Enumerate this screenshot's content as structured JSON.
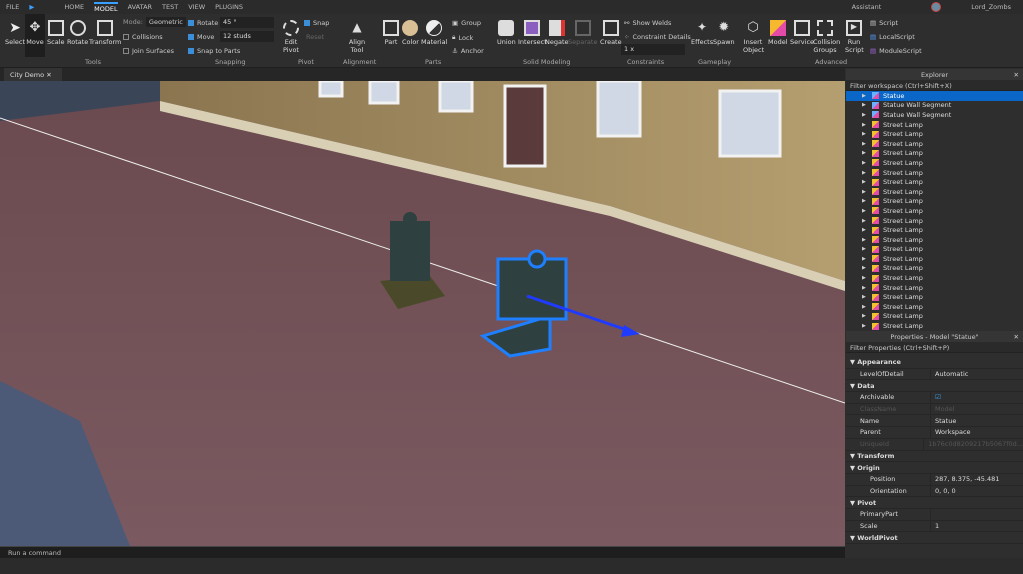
{
  "menubar": {
    "file": "FILE",
    "tabs": [
      "HOME",
      "MODEL",
      "AVATAR",
      "TEST",
      "VIEW",
      "PLUGINS"
    ],
    "active": "MODEL",
    "assistant": "Assistant",
    "user": "Lord_Zombs"
  },
  "tools": {
    "select": "Select",
    "move": "Move",
    "scale": "Scale",
    "rotate": "Rotate",
    "transform": "Transform",
    "mode_label": "Mode:",
    "mode": "Geometric",
    "collisions": "Collisions",
    "join": "Join Surfaces",
    "group": "Tools"
  },
  "snapping": {
    "rotate": "Rotate",
    "rotate_val": "45 °",
    "move": "Move",
    "move_val": "12 studs",
    "snap_parts": "Snap to Parts",
    "group": "Snapping"
  },
  "pivot": {
    "edit": "Edit Pivot",
    "snap": "Snap",
    "reset": "Reset",
    "group": "Pivot"
  },
  "alignment": {
    "align": "Align Tool",
    "group": "Alignment"
  },
  "parts": {
    "part": "Part",
    "color": "Color",
    "material": "Material",
    "group_btn": "Group",
    "lock": "Lock",
    "anchor": "Anchor",
    "group": "Parts"
  },
  "solid": {
    "union": "Union",
    "intersect": "Intersect",
    "negate": "Negate",
    "separate": "Separate",
    "group": "Solid Modeling"
  },
  "constraints": {
    "create": "Create",
    "welds": "Show Welds",
    "details": "Constraint Details",
    "scale": "1 x",
    "group": "Constraints"
  },
  "gameplay": {
    "effects": "Effects",
    "spawn": "Spawn",
    "group": "Gameplay"
  },
  "advanced": {
    "insert": "Insert Object",
    "model": "Model",
    "service": "Service",
    "collision": "Collision Groups",
    "run": "Run Script",
    "script": "Script",
    "local": "LocalScript",
    "module": "ModuleScript",
    "group": "Advanced"
  },
  "doc_tab": "City Demo",
  "command": "Run a command",
  "explorer": {
    "title": "Explorer",
    "filter": "Filter workspace (Ctrl+Shift+X)",
    "items": [
      "Statue",
      "Statue Wall Segment",
      "Statue Wall Segment",
      "Street Lamp",
      "Street Lamp",
      "Street Lamp",
      "Street Lamp",
      "Street Lamp",
      "Street Lamp",
      "Street Lamp",
      "Street Lamp",
      "Street Lamp",
      "Street Lamp",
      "Street Lamp",
      "Street Lamp",
      "Street Lamp",
      "Street Lamp",
      "Street Lamp",
      "Street Lamp",
      "Street Lamp",
      "Street Lamp",
      "Street Lamp",
      "Street Lamp",
      "Street Lamp",
      "Street Lamp"
    ]
  },
  "properties": {
    "title": "Properties - Model \"Statue\"",
    "filter": "Filter Properties (Ctrl+Shift+P)",
    "rows": [
      {
        "t": "cat",
        "k": "Appearance"
      },
      {
        "k": "LevelOfDetail",
        "v": "Automatic"
      },
      {
        "t": "cat",
        "k": "Data"
      },
      {
        "k": "Archivable",
        "v": "☑"
      },
      {
        "t": "dim",
        "k": "ClassName",
        "v": "Model"
      },
      {
        "k": "Name",
        "v": "Statue"
      },
      {
        "k": "Parent",
        "v": "Workspace"
      },
      {
        "t": "dim",
        "k": "UniqueId",
        "v": "1b76c0d8209217b5067f0d..."
      },
      {
        "t": "cat",
        "k": "Transform"
      },
      {
        "t": "cat",
        "k": "Origin"
      },
      {
        "t": "sub",
        "k": "Position",
        "v": "287, 8.375, -45.481"
      },
      {
        "t": "sub",
        "k": "Orientation",
        "v": "0, 0, 0"
      },
      {
        "t": "cat",
        "k": "Pivot"
      },
      {
        "k": "PrimaryPart",
        "v": ""
      },
      {
        "k": "Scale",
        "v": "1"
      },
      {
        "t": "cat",
        "k": "WorldPivot"
      }
    ]
  }
}
